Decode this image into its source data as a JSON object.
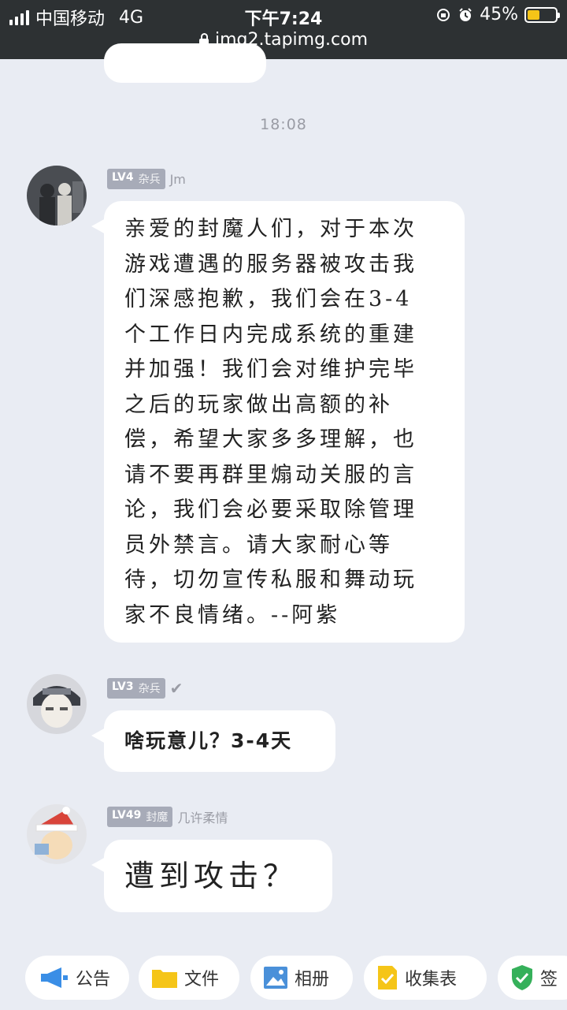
{
  "status_bar": {
    "carrier": "中国移动",
    "network": "4G",
    "time": "下午7:24",
    "battery": "45%",
    "battery_level": 0.45,
    "url": "img2.tapimg.com"
  },
  "chat": {
    "timestamp": "18:08",
    "messages": [
      {
        "level": "LV4",
        "title": "杂兵",
        "nickname": "Jm",
        "avatar_icon": "user-avatar-photo",
        "lines": [
          "亲爱的封魔人们，对于本次",
          "游戏遭遇的服务器被攻击我",
          "们深感抱歉，我们会在3-4",
          "个工作日内完成系统的重建",
          "并加强！我们会对维护完毕",
          "之后的玩家做出高额的补",
          "偿，希望大家多多理解，也",
          "请不要再群里煽动关服的言",
          "论，我们会必要采取除管理",
          "员外禁言。请大家耐心等",
          "待，切勿宣传私服和舞动玩",
          "家不良情绪。--阿紫"
        ]
      },
      {
        "level": "LV3",
        "title": "杂兵",
        "nickname": "",
        "avatar_icon": "anime-avatar",
        "text": "啥玩意儿？3-4天"
      },
      {
        "level": "LV49",
        "title": "封魔",
        "nickname": "几许柔情",
        "avatar_icon": "santa-hat-avatar",
        "text": "遭到攻击？"
      }
    ]
  },
  "toolbar": {
    "items": [
      {
        "label": "公告",
        "icon": "megaphone-icon",
        "color": "#3a8ee6"
      },
      {
        "label": "文件",
        "icon": "folder-icon",
        "color": "#f5c518"
      },
      {
        "label": "相册",
        "icon": "photo-icon",
        "color": "#4a90d9"
      },
      {
        "label": "收集表",
        "icon": "form-icon",
        "color": "#f5c518"
      },
      {
        "label": "签",
        "icon": "shield-check-icon",
        "color": "#35b05a"
      }
    ]
  }
}
